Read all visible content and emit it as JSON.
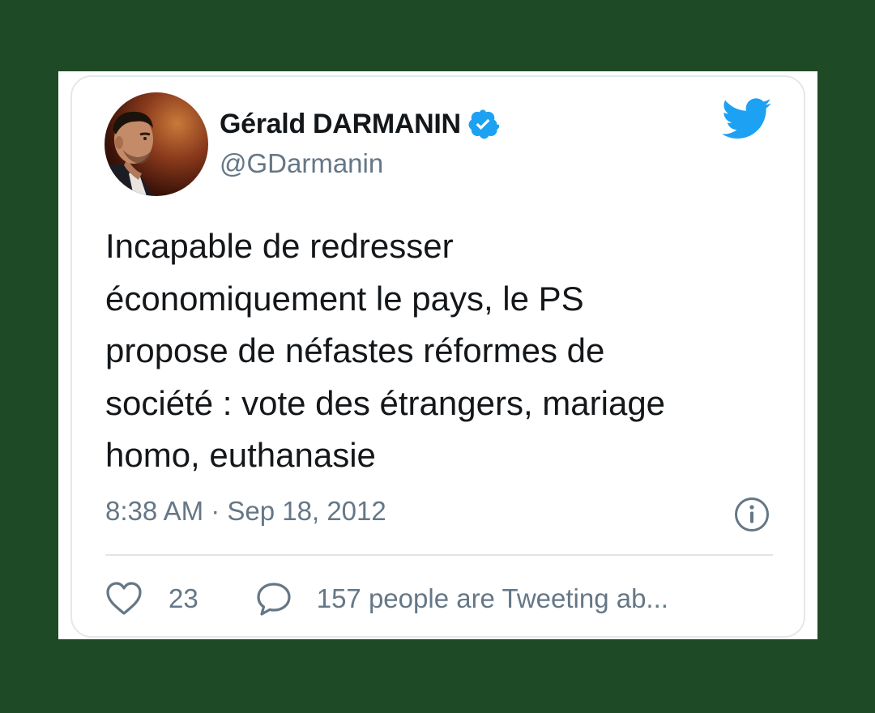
{
  "tweet": {
    "author": {
      "name": "Gérald DARMANIN",
      "handle": "@GDarmanin",
      "verified": true
    },
    "text": "Incapable de redresser\néconomiquement le pays, le PS\npropose de néfastes réformes de\nsociété : vote des étrangers, mariage\nhomo, euthanasie",
    "timestamp": "8:38 AM · Sep 18, 2012",
    "likes": "23",
    "conversation_text": "157 people are Tweeting ab..."
  },
  "icons": {
    "brand": "twitter-bird-icon",
    "verified": "verified-badge-icon",
    "info": "info-icon",
    "like": "heart-icon",
    "reply": "speech-bubble-icon"
  },
  "colors": {
    "background": "#1f4a26",
    "card": "#ffffff",
    "twitter_blue": "#1da1f2",
    "text_primary": "#14171a",
    "text_secondary": "#657786"
  }
}
